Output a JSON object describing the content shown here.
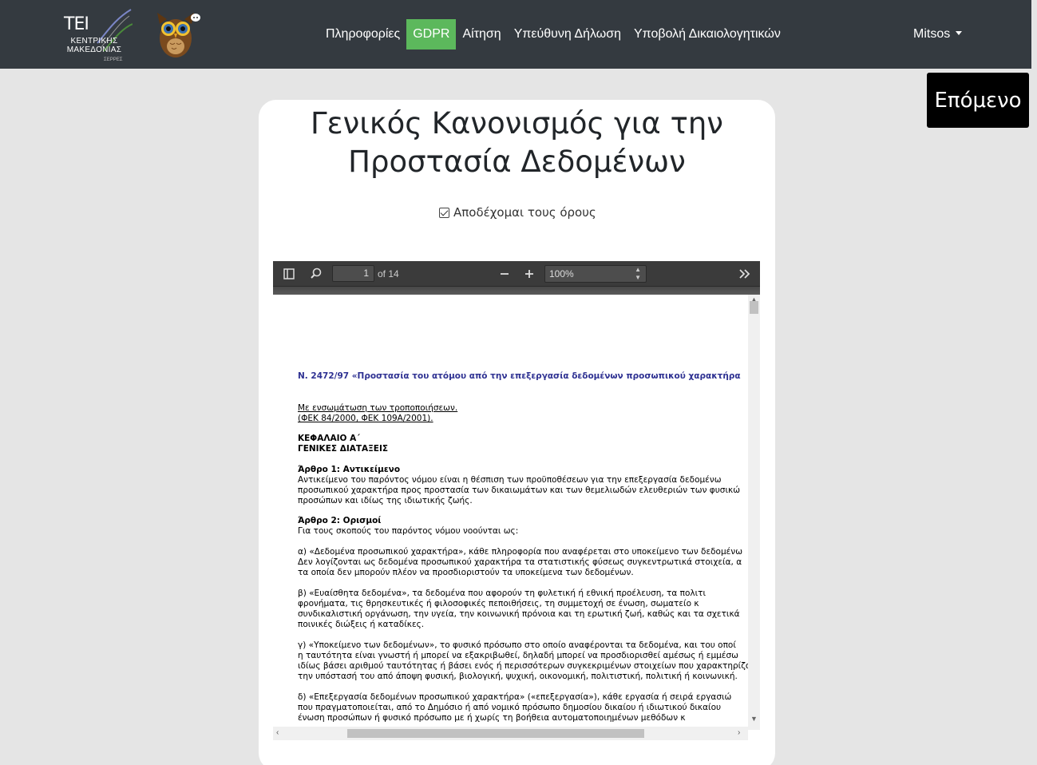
{
  "navbar": {
    "logo": {
      "text": "ΤΕΙ",
      "sub_line1": "ΚΕΝΤΡΙΚΗΣ",
      "sub_line2": "ΜΑΚΕΔΟΝΙΑΣ",
      "city": "ΣΕΡΡΕΣ"
    },
    "links": [
      {
        "label": "Πληροφορίες",
        "active": false
      },
      {
        "label": "GDPR",
        "active": true
      },
      {
        "label": "Αίτηση",
        "active": false
      },
      {
        "label": "Υπεύθυνη Δήλωση",
        "active": false
      },
      {
        "label": "Υποβολή Δικαιολογητικών",
        "active": false
      }
    ],
    "user": "Mitsos",
    "active_color": "#5cb85c",
    "bg_color": "#343a40"
  },
  "next_button": {
    "label": "Επόμενο"
  },
  "card": {
    "title": "Γενικός Κανονισμός για την Προστασία Δεδομένων",
    "accept_label": "Αποδέχομαι τους όρους",
    "accept_checked": true
  },
  "pdf_viewer": {
    "current_page": "1",
    "page_count_label": "of 14",
    "zoom": "100%",
    "icons": [
      "sidebar-toggle-icon",
      "search-icon",
      "zoom-out-icon",
      "zoom-in-icon",
      "tools-icon"
    ],
    "document": {
      "title": "Ν. 2472/97 «Προστασία του ατόμου από την επεξεργασία δεδομένων προσωπικού χαρακτήρα",
      "lines": [
        "Με ενσωμάτωση των τροποποιήσεων.",
        "(ΦΕΚ 84/2000, ΦΕΚ 109Α/2001).",
        "ΚΕΦΑΛΑΙΟ Α΄",
        "ΓΕΝΙΚΕΣ ΔΙΑΤΑΞΕΙΣ",
        "Άρθρο 1: Αντικείμενο",
        "Αντικείμενο του παρόντος νόμου είναι η θέσπιση των προϋποθέσεων για την επεξεργασία δεδομένω",
        "προσωπικού χαρακτήρα προς προστασία των δικαιωμάτων και των θεμελιωδών ελευθεριών των φυσικώ",
        "προσώπων και ιδίως της ιδιωτικής ζωής.",
        "Άρθρο 2: Ορισμοί",
        "Για τους σκοπούς του παρόντος νόμου νοούνται ως:",
        "α) «Δεδομένα προσωπικού χαρακτήρα», κάθε πληροφορία που αναφέρεται στο υποκείμενο των δεδομένω",
        "Δεν λογίζονται ως δεδομένα προσωπικού χαρακτήρα τα στατιστικής φύσεως συγκεντρωτικά στοιχεία, α",
        "τα οποία δεν μπορούν πλέον να προσδιοριστούν τα υποκείμενα των δεδομένων.",
        "β) «Ευαίσθητα δεδομένα», τα δεδομένα που αφορούν τη φυλετική ή εθνική προέλευση, τα πολιτι",
        "φρονήματα, τις θρησκευτικές ή φιλοσοφικές πεποιθήσεις, τη συμμετοχή σε ένωση, σωματείο κ",
        "συνδικαλιστική οργάνωση, την υγεία, την κοινωνική πρόνοια και τη ερωτική ζωή, καθώς και τα σχετικά",
        "ποινικές διώξεις ή καταδίκες.",
        "γ) «Υποκείμενο των δεδομένων», το φυσικό πρόσωπο στο οποίο αναφέρονται τα δεδομένα, και του οποί",
        "η ταυτότητα είναι γνωστή ή μπορεί να εξακριβωθεί, δηλαδή μπορεί να προσδιορισθεί αμέσως ή εμμέσω",
        "ιδίως βάσει αριθμού ταυτότητας ή βάσει ενός ή περισσότερων συγκεκριμένων στοιχείων που χαρακτηρίζο",
        "την υπόστασή του από άποψη φυσική, βιολογική, ψυχική, οικονομική, πολιτιστική, πολιτική ή κοινωνική.",
        "δ) «Επεξεργασία δεδομένων προσωπικού χαρακτήρα» («επεξεργασία»), κάθε εργασία ή σειρά εργασιώ",
        "που πραγματοποιείται, από το Δημόσιο ή από νομικό πρόσωπο δημοσίου δικαίου ή ιδιωτικού δικαίου",
        "ένωση προσώπων ή φυσικό πρόσωπο με ή χωρίς τη βοήθεια αυτοματοποιημένων μεθόδων κ"
      ]
    }
  }
}
